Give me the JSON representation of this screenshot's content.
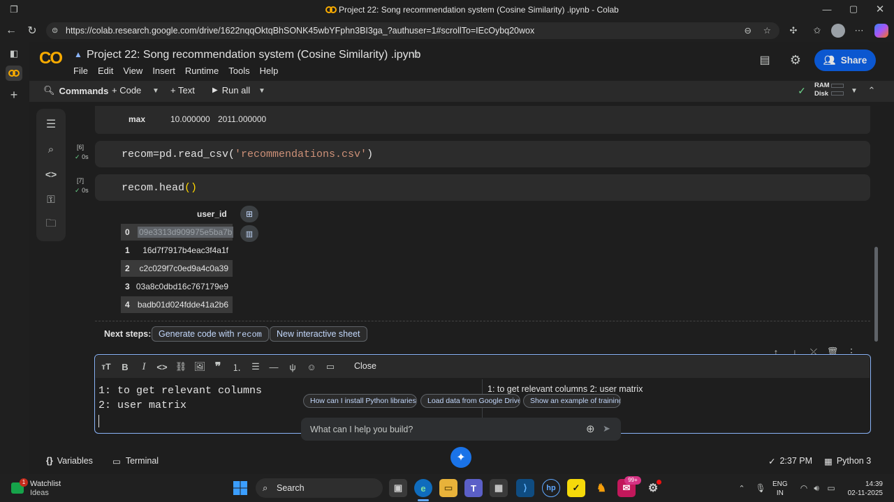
{
  "browser": {
    "tab_title": "Project 22: Song recommendation system (Cosine Similarity) .ipynb - Colab",
    "url": "https://colab.research.google.com/drive/1622nqqOktqBhSONK45wbYFphn3BI3ga_?authuser=1#scrollTo=IEcOybq20wox"
  },
  "colab": {
    "logo": "CO",
    "notebook_title": "Project 22: Song recommendation system (Cosine Similarity) .ipynb",
    "menu": [
      "File",
      "Edit",
      "View",
      "Insert",
      "Runtime",
      "Tools",
      "Help"
    ],
    "share_label": "Share",
    "toolbar": {
      "commands": "Commands",
      "code": "+ Code",
      "text": "+ Text",
      "run_all": "Run all",
      "ram": "RAM",
      "disk": "Disk"
    }
  },
  "cells": {
    "prev_output": {
      "label": "max",
      "v1": "10.000000",
      "v2": "2011.000000"
    },
    "cell6": {
      "count": "[6]",
      "time": "0s",
      "code_pre": "recom=pd.read_csv(",
      "code_str": "'recommendations.csv'",
      "code_post": ")"
    },
    "cell7": {
      "count": "[7]",
      "time": "0s",
      "code_pre": "recom.head",
      "code_post": "()"
    },
    "table": {
      "header": "user_id",
      "rows": [
        {
          "idx": "0",
          "val": "09e3313d909975e5ba7b"
        },
        {
          "idx": "1",
          "val": "16d7f7917b4eac3f4a1f"
        },
        {
          "idx": "2",
          "val": "c2c029f7c0ed9a4c0a39"
        },
        {
          "idx": "3",
          "val": "03a8c0dbd16c767179e9"
        },
        {
          "idx": "4",
          "val": "badb01d024fdde41a2b6"
        }
      ]
    },
    "next_steps": {
      "label": "Next steps:",
      "chip1_pre": "Generate code with ",
      "chip1_code": "recom",
      "chip2": "New interactive sheet"
    }
  },
  "editor": {
    "close_label": "Close",
    "line1": "1: to get relevant columns",
    "line2": "2: user matrix",
    "preview": "1: to get relevant columns 2: user matrix"
  },
  "gemini": {
    "suggestions": [
      "How can I install Python libraries?",
      "Load data from Google Drive",
      "Show an example of training a"
    ],
    "placeholder": "What can I help you build?"
  },
  "status": {
    "variables": "Variables",
    "terminal": "Terminal",
    "time": "2:37 PM",
    "kernel": "Python 3"
  },
  "taskbar": {
    "watchlist": "Watchlist",
    "ideas": "Ideas",
    "badge": "1",
    "search": "Search",
    "lang1": "ENG",
    "lang2": "IN",
    "clock": "14:39",
    "date": "02-11-2025",
    "notif_badge": "99+"
  }
}
